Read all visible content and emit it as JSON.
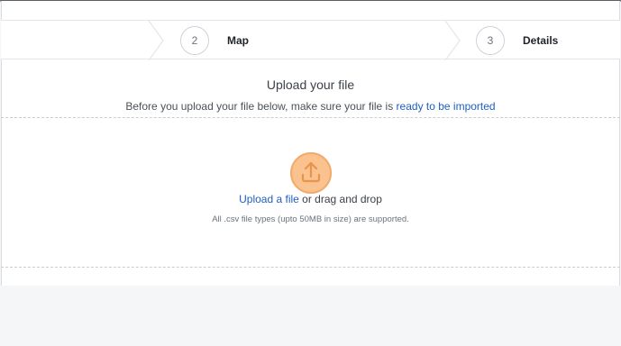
{
  "stepper": {
    "steps": [
      {
        "number": "2",
        "label": "Map"
      },
      {
        "number": "3",
        "label": "Details"
      }
    ]
  },
  "upload": {
    "title": "Upload your file",
    "subtitle_prefix": "Before you upload your file below, make sure your file is ",
    "subtitle_link": "ready to be imported",
    "link_text": "Upload a file",
    "or_text": " or drag and drop",
    "note": "All .csv file types (upto 50MB in size) are supported."
  },
  "colors": {
    "accent_link": "#1f5fbf",
    "upload_icon_fill": "#f9c28e",
    "upload_icon_stroke": "#f3a968"
  },
  "icons": {
    "upload": "upload-arrow-icon",
    "chevron": "step-chevron-icon"
  }
}
